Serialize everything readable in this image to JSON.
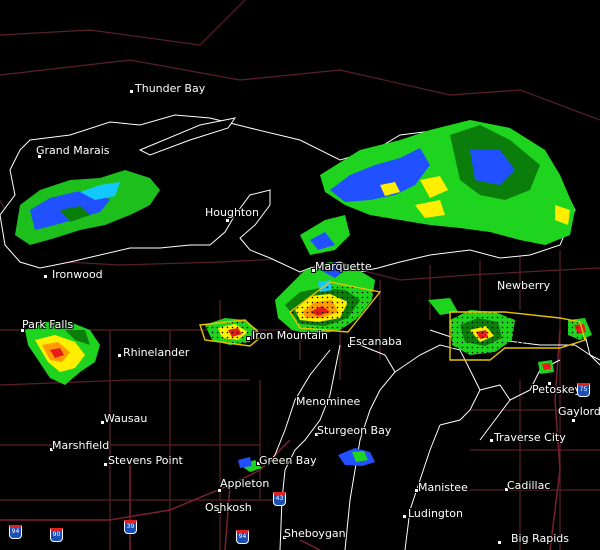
{
  "map": {
    "cities": [
      {
        "id": "thunder-bay",
        "name": "Thunder Bay"
      },
      {
        "id": "grand-marais",
        "name": "Grand Marais"
      },
      {
        "id": "houghton",
        "name": "Houghton"
      },
      {
        "id": "ironwood",
        "name": "Ironwood"
      },
      {
        "id": "marquette",
        "name": "Marquette"
      },
      {
        "id": "newberry",
        "name": "Newberry"
      },
      {
        "id": "park-falls",
        "name": "Park Falls"
      },
      {
        "id": "rhinelander",
        "name": "Rhinelander"
      },
      {
        "id": "iron-mountain",
        "name": "Iron Mountain"
      },
      {
        "id": "escanaba",
        "name": "Escanaba"
      },
      {
        "id": "petoskey",
        "name": "Petoskey"
      },
      {
        "id": "wausau",
        "name": "Wausau"
      },
      {
        "id": "menominee",
        "name": "Menominee"
      },
      {
        "id": "gaylord",
        "name": "Gaylord"
      },
      {
        "id": "marshfield",
        "name": "Marshfield"
      },
      {
        "id": "sturgeon-bay",
        "name": "Sturgeon Bay"
      },
      {
        "id": "traverse-city",
        "name": "Traverse City"
      },
      {
        "id": "stevens-point",
        "name": "Stevens Point"
      },
      {
        "id": "green-bay",
        "name": "Green Bay"
      },
      {
        "id": "appleton",
        "name": "Appleton"
      },
      {
        "id": "manistee",
        "name": "Manistee"
      },
      {
        "id": "cadillac",
        "name": "Cadillac"
      },
      {
        "id": "oshkosh",
        "name": "Oshkosh"
      },
      {
        "id": "ludington",
        "name": "Ludington"
      },
      {
        "id": "sheboygan",
        "name": "Sheboygan"
      },
      {
        "id": "big-rapids",
        "name": "Big Rapids"
      }
    ],
    "highways": [
      {
        "id": "i-75",
        "label": "75"
      },
      {
        "id": "i-43",
        "label": "43"
      },
      {
        "id": "i-39",
        "label": "39"
      },
      {
        "id": "i-90",
        "label": "90"
      },
      {
        "id": "i-94",
        "label": "94"
      },
      {
        "id": "i-94-west",
        "label": "94"
      }
    ],
    "colors": {
      "background": "#000000",
      "boundary": "#5a1f2a",
      "coastline": "#ffffff",
      "warning_polygon": "#e8c200",
      "radar_light": "#0f8f1f",
      "radar_green": "#1fd41f",
      "radar_dark_green": "#0a7d0a",
      "radar_blue": "#2050ff",
      "radar_cyan": "#12c8ff",
      "radar_yellow": "#ffee00",
      "radar_orange": "#ff9a00",
      "radar_red": "#e81b1b"
    }
  }
}
